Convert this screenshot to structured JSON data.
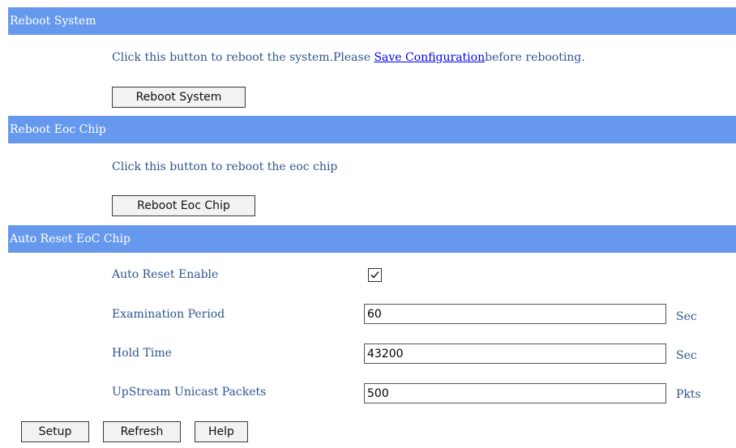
{
  "reboot_system": {
    "header": "Reboot System",
    "text_before": "Click this button to reboot the system.Please ",
    "link": "Save Configuration",
    "text_after": "before rebooting.",
    "button": "Reboot System"
  },
  "reboot_eoc": {
    "header": "Reboot Eoc Chip",
    "text": "Click this button to reboot the eoc chip",
    "button": "Reboot Eoc Chip"
  },
  "auto_reset": {
    "header": "Auto Reset EoC Chip",
    "enable_label": "Auto Reset Enable",
    "enable_checked": true,
    "period_label": "Examination Period",
    "period_value": "60",
    "period_unit": "Sec",
    "hold_label": "Hold Time",
    "hold_value": "43200",
    "hold_unit": "Sec",
    "packets_label": "UpStream Unicast Packets",
    "packets_value": "500",
    "packets_unit": "Pkts"
  },
  "footer": {
    "setup": "Setup",
    "refresh": "Refresh",
    "help": "Help"
  }
}
